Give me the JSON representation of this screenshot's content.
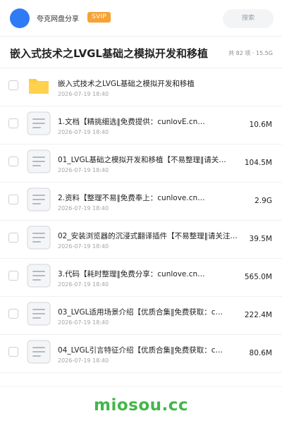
{
  "header": {
    "share_name": "夸克网盘分享",
    "badge": "SVIP",
    "search_placeholder": "搜索",
    "avatar_color": "#2f7bf6",
    "badge_color": "#f7a233"
  },
  "folder": {
    "title": "嵌入式技术之LVGL基础之模拟开发和移植",
    "meta": "共 82 项 · 15.5G"
  },
  "files": [
    {
      "name": "嵌入式技术之LVGL基础之模拟开发和移植",
      "date": "2026-07-19 18:40",
      "size": "",
      "icon": "folder-icon"
    },
    {
      "name": "1.文档【精挑细选‖免费提供：cunlovE.cn…",
      "date": "2026-07-19 18:40",
      "size": "10.6M",
      "icon": "document-icon"
    },
    {
      "name": "01_LVGL基础之模拟开发和移植【不易整理‖请关…",
      "date": "2026-07-19 18:40",
      "size": "104.5M",
      "icon": "document-icon"
    },
    {
      "name": "2.资料【整理不易‖免费奉上：cunlove.cn…",
      "date": "2026-07-19 18:40",
      "size": "2.9G",
      "icon": "document-icon"
    },
    {
      "name": "02_安装浏览器的沉浸式翻译插件【不易整理‖请关注…",
      "date": "2026-07-19 18:40",
      "size": "39.5M",
      "icon": "document-icon"
    },
    {
      "name": "3.代码【耗时整理‖免费分享：cunlove.cn…",
      "date": "2026-07-19 18:40",
      "size": "565.0M",
      "icon": "document-icon"
    },
    {
      "name": "03_LVGL适用场景介绍【优质合集‖免费获取：c…",
      "date": "2026-07-19 18:40",
      "size": "222.4M",
      "icon": "document-icon"
    },
    {
      "name": "04_LVGL引言特征介绍【优质合集‖免费获取：c…",
      "date": "2026-07-19 18:40",
      "size": "80.6M",
      "icon": "document-icon"
    }
  ],
  "watermark": "miosou.cc",
  "colors": {
    "folder": "#ffc93c",
    "watermark": "#43b649"
  }
}
